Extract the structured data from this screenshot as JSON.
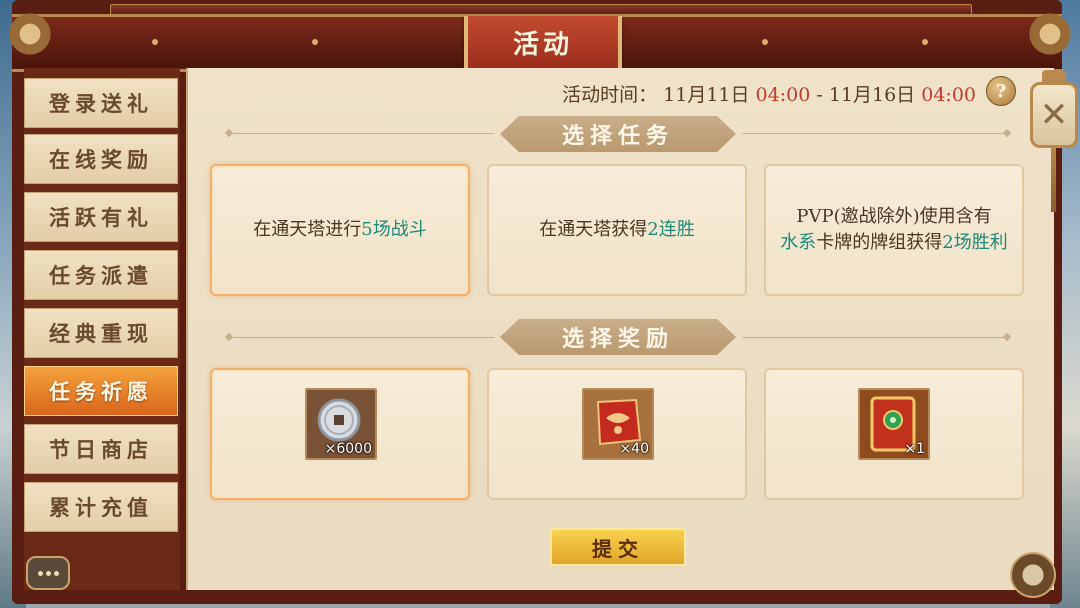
{
  "window": {
    "title": "活动"
  },
  "event_time": {
    "label": "活动时间：",
    "start_date": "11月11日",
    "start_time": "04:00",
    "separator": "-",
    "end_date": "11月16日",
    "end_time": "04:00"
  },
  "help": {
    "label": "?"
  },
  "sidebar": {
    "items": [
      {
        "label": "登录送礼",
        "active": false
      },
      {
        "label": "在线奖励",
        "active": false
      },
      {
        "label": "活跃有礼",
        "active": false
      },
      {
        "label": "任务派遣",
        "active": false
      },
      {
        "label": "经典重现",
        "active": false
      },
      {
        "label": "任务祈愿",
        "active": true
      },
      {
        "label": "节日商店",
        "active": false
      },
      {
        "label": "累计充值",
        "active": false
      }
    ]
  },
  "tasks": {
    "header": "选择任务",
    "cards": [
      {
        "prefix": "在通天塔进行",
        "highlight": "5场战斗",
        "suffix": "",
        "selected": true
      },
      {
        "prefix": "在通天塔获得",
        "highlight": "2连胜",
        "suffix": "",
        "selected": false
      },
      {
        "line1": "PVP(邀战除外)使用含有",
        "highlight1": "水系",
        "mid": "卡牌的牌组获得",
        "highlight2": "2场胜利",
        "selected": false
      }
    ]
  },
  "rewards": {
    "header": "选择奖励",
    "items": [
      {
        "icon": "copper-coin-icon",
        "quantity": "×6000",
        "selected": true
      },
      {
        "icon": "red-pouch-icon",
        "quantity": "×40",
        "selected": false
      },
      {
        "icon": "jade-card-icon",
        "quantity": "×1",
        "selected": false
      }
    ]
  },
  "submit": {
    "label": "提交"
  },
  "colors": {
    "accent_orange": "#e0741f",
    "highlight_teal": "#1e8a7a",
    "time_red": "#c23b2b",
    "frame_maroon": "#5a1d12"
  }
}
